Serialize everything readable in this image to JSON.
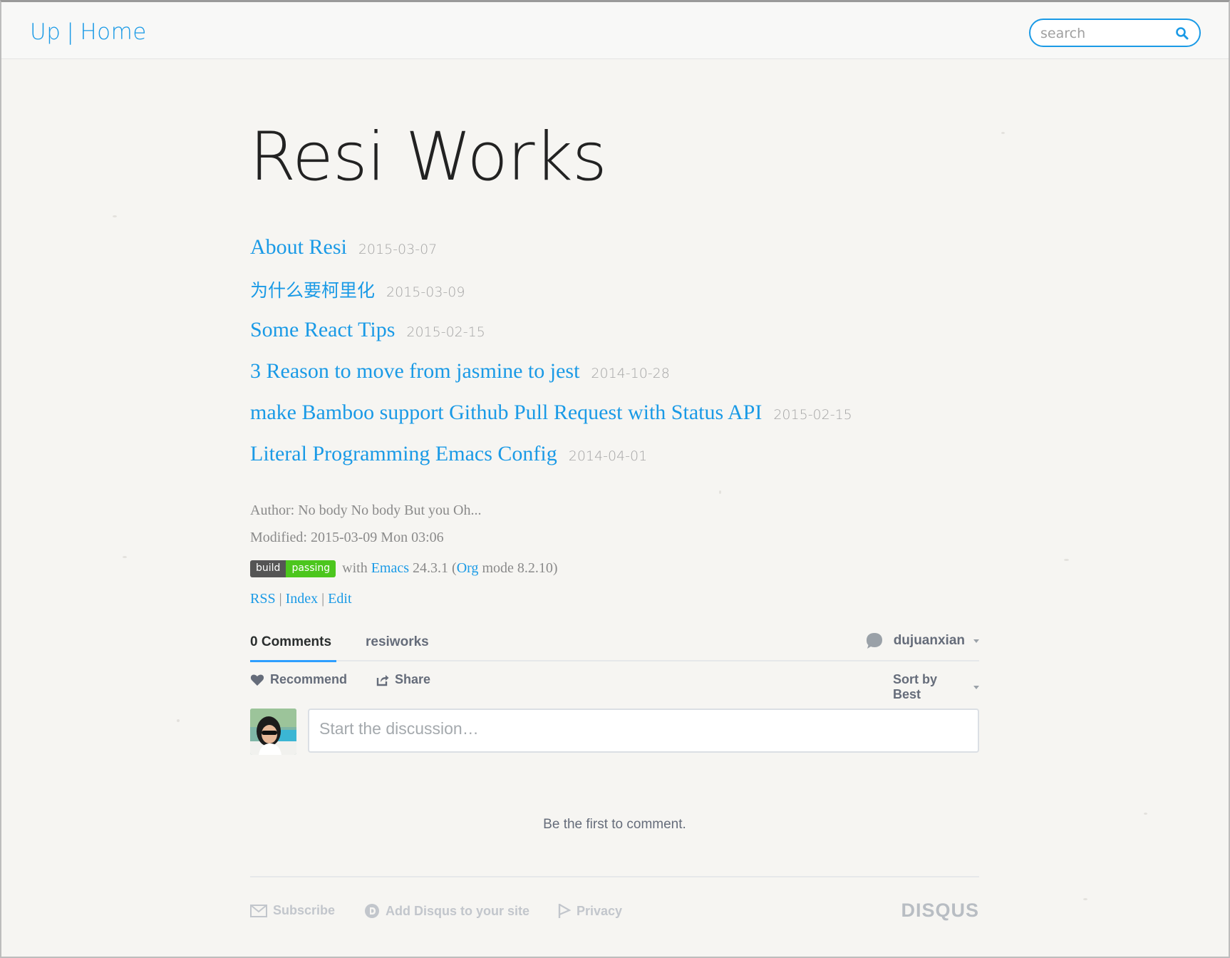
{
  "nav": {
    "up": "Up",
    "separator": "|",
    "home": "Home"
  },
  "search": {
    "placeholder": "search",
    "icon": "magnifier-icon"
  },
  "page": {
    "title": "Resi Works"
  },
  "posts": [
    {
      "title": "About Resi",
      "date": "2015-03-07"
    },
    {
      "title": "为什么要柯里化",
      "date": "2015-03-09"
    },
    {
      "title": "Some React Tips",
      "date": "2015-02-15"
    },
    {
      "title": "3 Reason to move from jasmine to jest",
      "date": "2014-10-28"
    },
    {
      "title": "make Bamboo support Github Pull Request with Status API",
      "date": "2015-02-15"
    },
    {
      "title": "Literal Programming Emacs Config",
      "date": "2014-04-01"
    }
  ],
  "meta": {
    "author": "Author: No body No body But you Oh...",
    "modified": "Modified: 2015-03-09 Mon 03:06",
    "badge_left": "build",
    "badge_right": "passing",
    "with": "with",
    "emacs": "Emacs",
    "emacs_version": "24.3.1 (",
    "org": "Org",
    "org_version": "mode 8.2.10)",
    "links": [
      "RSS",
      "Index",
      "Edit"
    ],
    "link_separator": "|"
  },
  "disqus": {
    "tab_comments": "0 Comments",
    "tab_forum": "resiworks",
    "user": "dujuanxian",
    "recommend": "Recommend",
    "share": "Share",
    "sort": "Sort by Best",
    "input_placeholder": "Start the discussion…",
    "empty": "Be the first to comment.",
    "subscribe": "Subscribe",
    "add_disqus": "Add Disqus to your site",
    "privacy": "Privacy",
    "logo": "DISQUS"
  },
  "colors": {
    "link": "#1a9ae6",
    "badge_pass": "#4cc61e",
    "badge_dark": "#555555",
    "tab_accent": "#2e9fff"
  }
}
